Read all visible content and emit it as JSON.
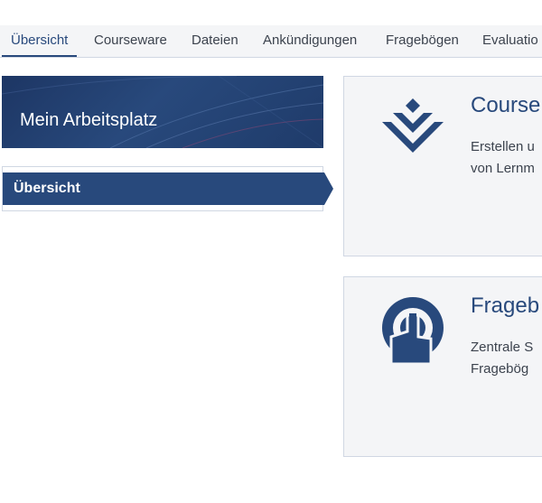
{
  "tabs": [
    {
      "label": "Übersicht",
      "active": true
    },
    {
      "label": "Courseware",
      "active": false
    },
    {
      "label": "Dateien",
      "active": false
    },
    {
      "label": "Ankündigungen",
      "active": false
    },
    {
      "label": "Fragebögen",
      "active": false
    },
    {
      "label": "Evaluatio",
      "active": false
    }
  ],
  "workspace": {
    "title": "Mein Arbeitsplatz"
  },
  "sidebar": {
    "items": [
      {
        "label": "Übersicht",
        "active": true
      }
    ]
  },
  "cards": [
    {
      "title": "Course",
      "description_line1": "Erstellen u",
      "description_line2": "von Lernm",
      "icon": "courseware-layers-icon"
    },
    {
      "title": "Frageb",
      "description_line1": "Zentrale S",
      "description_line2": "Fragebög",
      "icon": "touch-hand-icon"
    }
  ],
  "colors": {
    "primary": "#28497c",
    "tab_bg": "#f4f5f7",
    "card_bg": "#f4f5f7",
    "border": "#d0d7e3",
    "text": "#3c434e"
  }
}
